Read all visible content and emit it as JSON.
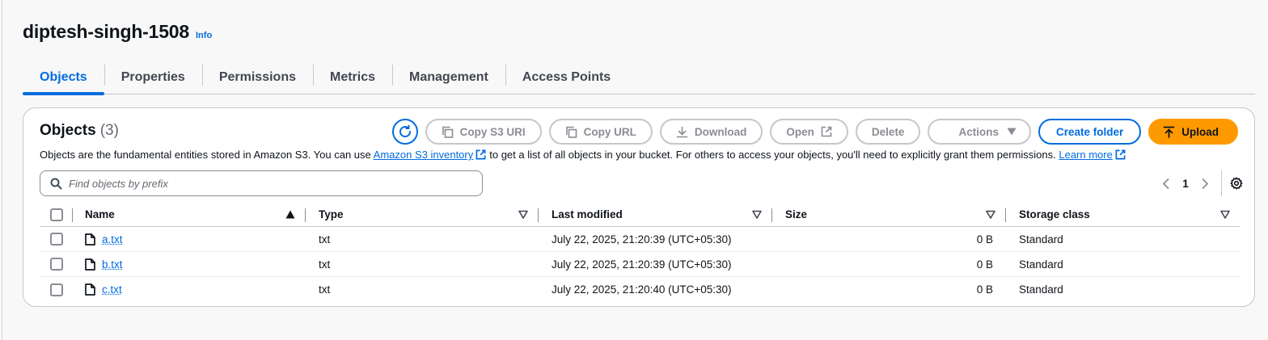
{
  "bucket": {
    "name": "diptesh-singh-1508",
    "info_label": "Info"
  },
  "tabs": [
    "Objects",
    "Properties",
    "Permissions",
    "Metrics",
    "Management",
    "Access Points"
  ],
  "active_tab": "Objects",
  "objects_panel": {
    "title": "Objects",
    "count": "(3)",
    "toolbar": {
      "copy_s3_uri": "Copy S3 URI",
      "copy_url": "Copy URL",
      "download": "Download",
      "open": "Open",
      "delete": "Delete",
      "actions": "Actions",
      "create_folder": "Create folder",
      "upload": "Upload"
    },
    "description": {
      "part1": "Objects are the fundamental entities stored in Amazon S3. You can use",
      "inventory_link": "Amazon S3 inventory",
      "part2": "to get a list of all objects in your bucket. For others to access your objects, you'll need to explicitly grant them permissions.",
      "learn_more": "Learn more"
    },
    "search": {
      "placeholder": "Find objects by prefix",
      "value": ""
    },
    "pagination": {
      "current_page": "1"
    },
    "columns": [
      "Name",
      "Type",
      "Last modified",
      "Size",
      "Storage class"
    ],
    "rows": [
      {
        "name": "a.txt",
        "type": "txt",
        "last_modified": "July 22, 2025, 21:20:39 (UTC+05:30)",
        "size": "0 B",
        "storage_class": "Standard"
      },
      {
        "name": "b.txt",
        "type": "txt",
        "last_modified": "July 22, 2025, 21:20:39 (UTC+05:30)",
        "size": "0 B",
        "storage_class": "Standard"
      },
      {
        "name": "c.txt",
        "type": "txt",
        "last_modified": "July 22, 2025, 21:20:40 (UTC+05:30)",
        "size": "0 B",
        "storage_class": "Standard"
      }
    ]
  },
  "colors": {
    "accent": "#006ce0",
    "upload": "#ff9900",
    "border": "#c6c6cd",
    "disabled_text": "#8c8c94"
  },
  "icons": [
    "refresh-icon",
    "copy-icon",
    "download-icon",
    "external-link-icon",
    "caret-down-icon",
    "upload-arrow-icon",
    "search-icon",
    "chevron-left-icon",
    "chevron-right-icon",
    "settings-gear-icon",
    "file-icon",
    "sort-ascending-icon",
    "sort-icon"
  ]
}
